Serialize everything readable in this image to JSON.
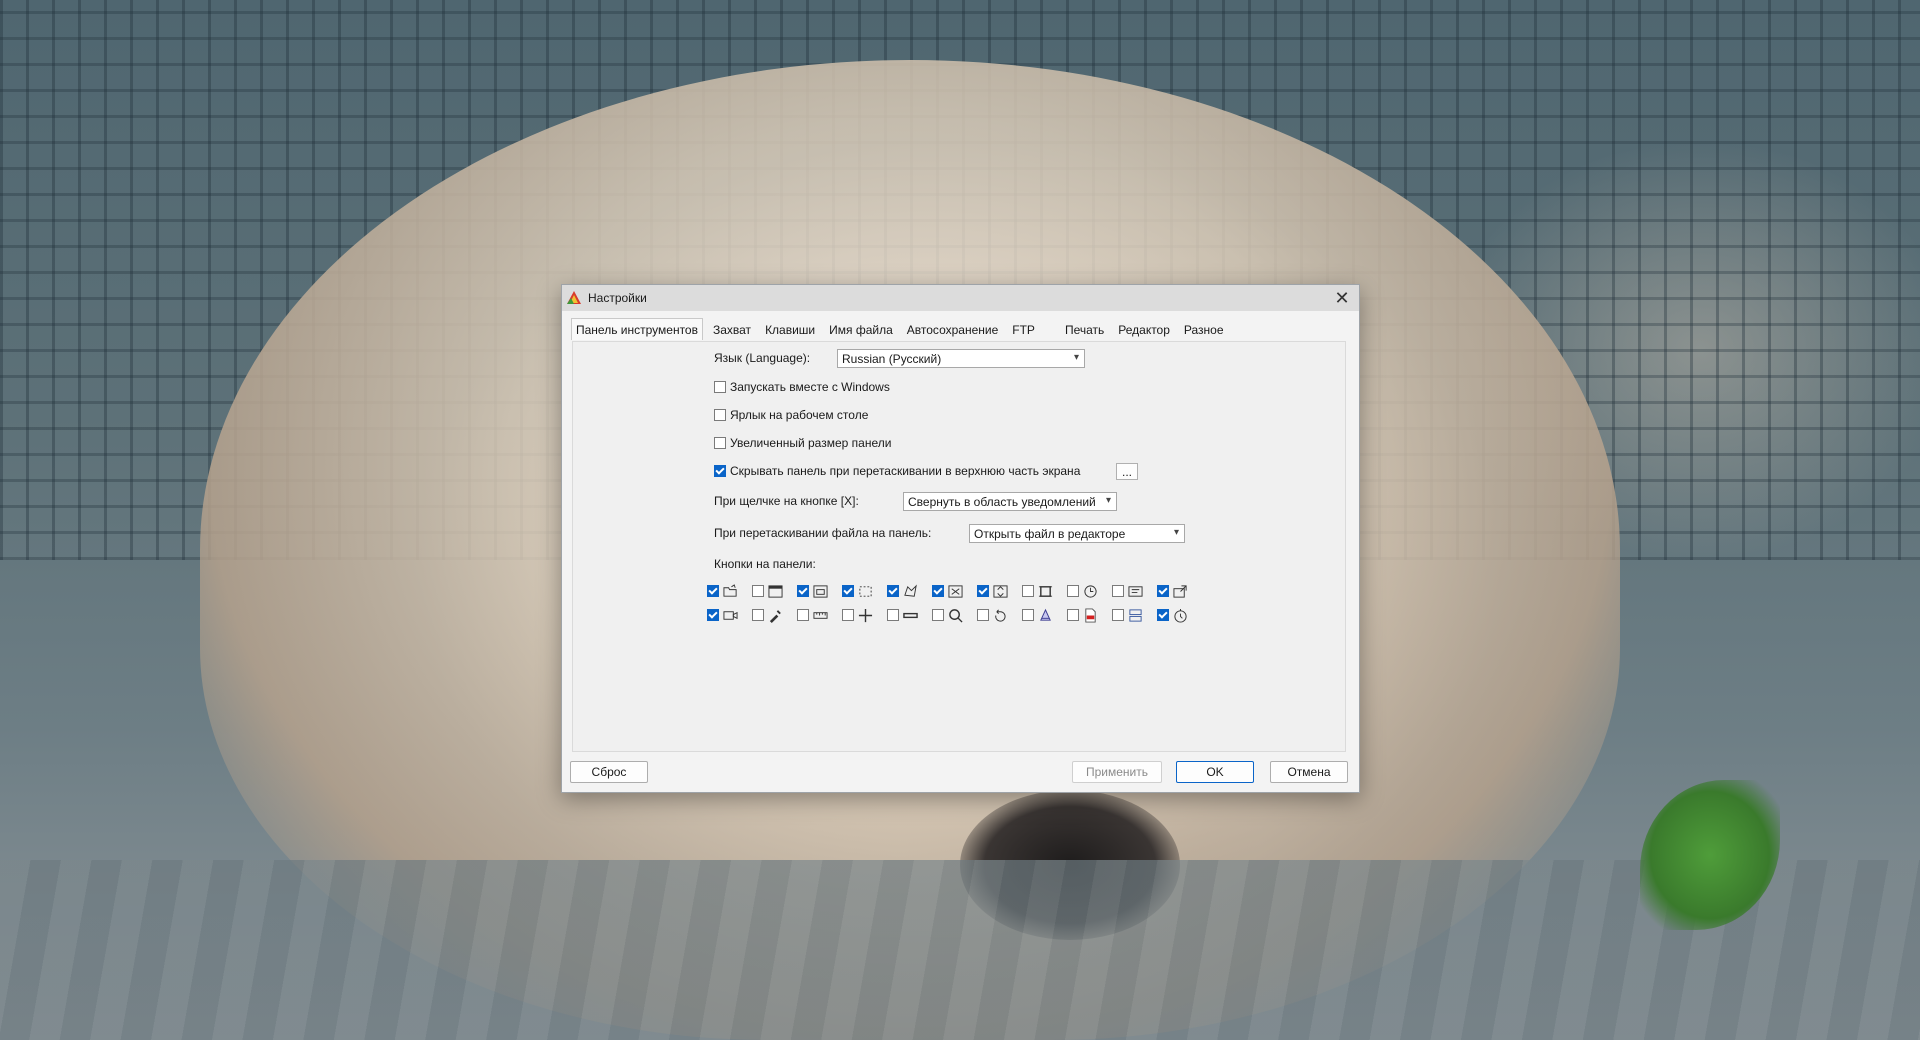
{
  "window": {
    "title": "Настройки",
    "close_glyph": "✕"
  },
  "tabs": [
    {
      "label": "Панель инструментов",
      "active": true
    },
    {
      "label": "Захват"
    },
    {
      "label": "Клавиши"
    },
    {
      "label": "Имя файла"
    },
    {
      "label": "Автосохранение"
    },
    {
      "label": "FTP"
    },
    {
      "label": "Печать"
    },
    {
      "label": "Редактор"
    },
    {
      "label": "Разное"
    }
  ],
  "settings": {
    "language_label": "Язык (Language):",
    "language_value": "Russian (Русский)",
    "start_with_windows": {
      "label": "Запускать вместе с Windows",
      "checked": false
    },
    "desktop_shortcut": {
      "label": "Ярлык на рабочем столе",
      "checked": false
    },
    "large_panel": {
      "label": "Увеличенный размер панели",
      "checked": false
    },
    "hide_panel": {
      "label": "Скрывать панель при перетаскивании в верхнюю часть экрана",
      "checked": true
    },
    "hide_panel_more": "...",
    "close_click_label": "При щелчке на кнопке [X]:",
    "close_click_value": "Свернуть в область уведомлений",
    "drag_file_label": "При перетаскивании файла на панель:",
    "drag_file_value": "Открыть файл в редакторе",
    "panel_buttons_label": "Кнопки на панели:"
  },
  "panel_buttons": {
    "row1": [
      {
        "icon": "open-folder-icon",
        "checked": true
      },
      {
        "icon": "window-icon",
        "checked": false
      },
      {
        "icon": "window-content-icon",
        "checked": true
      },
      {
        "icon": "rect-region-icon",
        "checked": true
      },
      {
        "icon": "freehand-region-icon",
        "checked": true
      },
      {
        "icon": "fullscreen-icon",
        "checked": true
      },
      {
        "icon": "scroll-window-icon",
        "checked": true
      },
      {
        "icon": "fixed-region-icon",
        "checked": false
      },
      {
        "icon": "timer-icon",
        "checked": false
      },
      {
        "icon": "text-capture-icon",
        "checked": false
      },
      {
        "icon": "export-icon",
        "checked": true
      }
    ],
    "row2": [
      {
        "icon": "video-icon",
        "checked": true
      },
      {
        "icon": "color-picker-icon",
        "checked": false
      },
      {
        "icon": "ruler-icon",
        "checked": false
      },
      {
        "icon": "crosshair-icon",
        "checked": false
      },
      {
        "icon": "minus-bar-icon",
        "checked": false
      },
      {
        "icon": "magnifier-icon",
        "checked": false
      },
      {
        "icon": "undo-icon",
        "checked": false
      },
      {
        "icon": "print-icon",
        "checked": false
      },
      {
        "icon": "pdf-icon",
        "checked": false
      },
      {
        "icon": "compare-icon",
        "checked": false
      },
      {
        "icon": "clock-arrow-icon",
        "checked": true
      }
    ]
  },
  "buttons": {
    "reset": "Сброс",
    "apply": "Применить",
    "ok": "OK",
    "cancel": "Отмена"
  },
  "colors": {
    "accent": "#0a64c8",
    "dialog_bg": "#f3f3f3",
    "titlebar_bg": "#dcdcdc"
  }
}
